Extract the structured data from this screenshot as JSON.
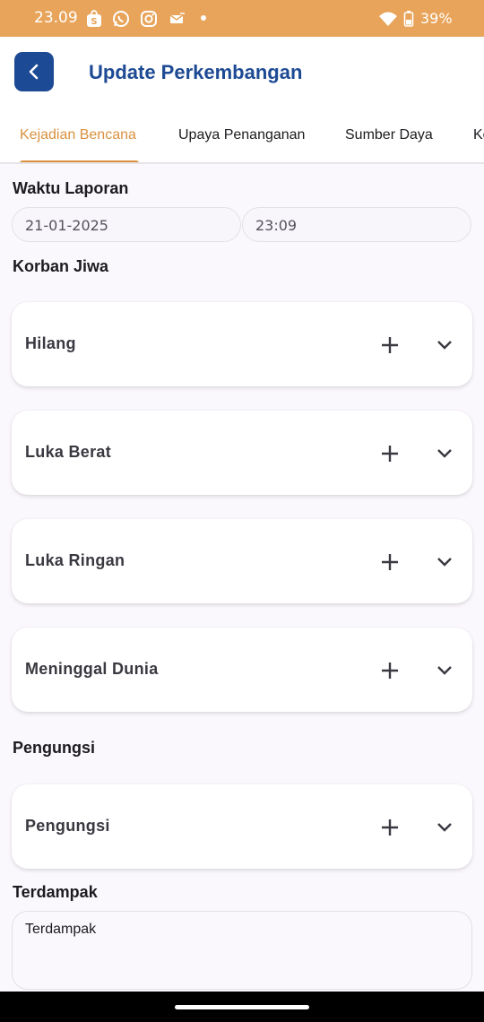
{
  "status_bar": {
    "time": "23.09",
    "battery": "39%",
    "icons": [
      "shopee-icon",
      "whatsapp-icon",
      "instagram-icon",
      "mail-icon",
      "notification-dot",
      "wifi-icon",
      "battery-icon"
    ]
  },
  "header": {
    "title": "Update Perkembangan",
    "back_icon": "chevron-left-icon"
  },
  "tabs": [
    {
      "label": "Kejadian Bencana",
      "active": true
    },
    {
      "label": "Upaya Penanganan",
      "active": false
    },
    {
      "label": "Sumber Daya",
      "active": false
    },
    {
      "label": "Ke",
      "active": false
    }
  ],
  "form": {
    "waktu_laporan": {
      "label": "Waktu Laporan",
      "date": "21-01-2025",
      "time": "23:09"
    },
    "korban_jiwa": {
      "label": "Korban Jiwa",
      "items": [
        {
          "label": "Hilang"
        },
        {
          "label": "Luka Berat"
        },
        {
          "label": "Luka Ringan"
        },
        {
          "label": "Meninggal Dunia"
        }
      ]
    },
    "pengungsi": {
      "label": "Pengungsi",
      "items": [
        {
          "label": "Pengungsi"
        }
      ]
    },
    "terdampak": {
      "label": "Terdampak",
      "placeholder": "Terdampak"
    }
  },
  "colors": {
    "status_bar": "#e8a45a",
    "primary": "#1d4a94",
    "accent": "#d9913f",
    "background": "#fbf8fd"
  }
}
